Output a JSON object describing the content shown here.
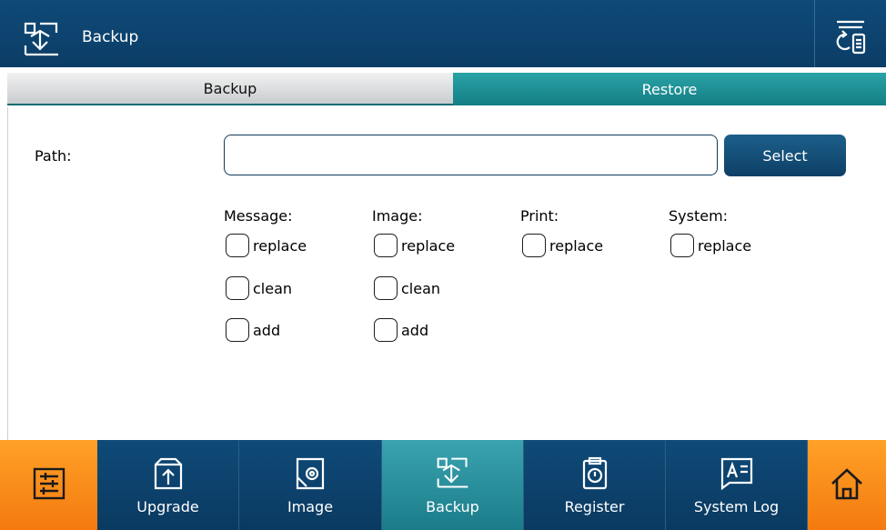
{
  "header": {
    "title": "Backup",
    "app_icon": "backup-icon",
    "right_icon": "usb-device-icon"
  },
  "tabs": [
    {
      "label": "Backup",
      "active": true
    },
    {
      "label": "Restore",
      "active": false
    }
  ],
  "path": {
    "label": "Path:",
    "value": "",
    "select_label": "Select"
  },
  "groups": [
    {
      "label": "Message:",
      "options": [
        "replace",
        "clean",
        "add"
      ]
    },
    {
      "label": "Image:",
      "options": [
        "replace",
        "clean",
        "add"
      ]
    },
    {
      "label": "Print:",
      "options": [
        "replace"
      ]
    },
    {
      "label": "System:",
      "options": [
        "replace"
      ]
    }
  ],
  "nav": [
    {
      "icon": "settings-sliders-icon",
      "label": ""
    },
    {
      "icon": "upload-box-icon",
      "label": "Upgrade"
    },
    {
      "icon": "image-icon",
      "label": "Image"
    },
    {
      "icon": "backup-icon",
      "label": "Backup"
    },
    {
      "icon": "register-clipboard-icon",
      "label": "Register"
    },
    {
      "icon": "system-log-icon",
      "label": "System Log"
    },
    {
      "icon": "home-icon",
      "label": ""
    }
  ],
  "colors": {
    "header_bg": "#0f4a78",
    "active_tab": "#1b7c89",
    "orange": "#f47a10"
  }
}
